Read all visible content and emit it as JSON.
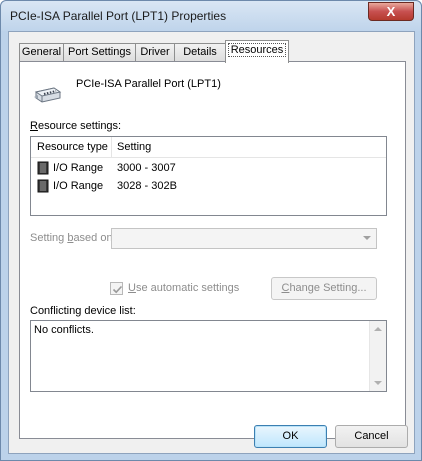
{
  "window": {
    "title": "PCIe-ISA Parallel Port (LPT1) Properties",
    "close_glyph": "X"
  },
  "tabs": [
    "General",
    "Port Settings",
    "Driver",
    "Details",
    "Resources"
  ],
  "active_tab": "Resources",
  "device": {
    "name": "PCIe-ISA Parallel Port (LPT1)",
    "icon": "parallel-port-icon"
  },
  "resource_settings": {
    "label_accel": "R",
    "label_rest": "esource settings:",
    "columns": [
      "Resource type",
      "Setting"
    ],
    "rows": [
      {
        "type": "I/O Range",
        "setting": "3000 - 3007",
        "icon": "io-range-icon"
      },
      {
        "type": "I/O Range",
        "setting": "3028 - 302B",
        "icon": "io-range-icon"
      }
    ]
  },
  "setting_based_on": {
    "label_pre": "Setting ",
    "label_accel": "b",
    "label_post": "ased on:",
    "value": ""
  },
  "automatic": {
    "label_accel": "U",
    "label_rest": "se automatic settings",
    "checked": true
  },
  "change_setting": {
    "label_accel": "C",
    "label_rest": "hange Setting..."
  },
  "conflicts": {
    "label": "Conflicting device list:",
    "text": "No conflicts."
  },
  "buttons": {
    "ok": "OK",
    "cancel": "Cancel"
  }
}
